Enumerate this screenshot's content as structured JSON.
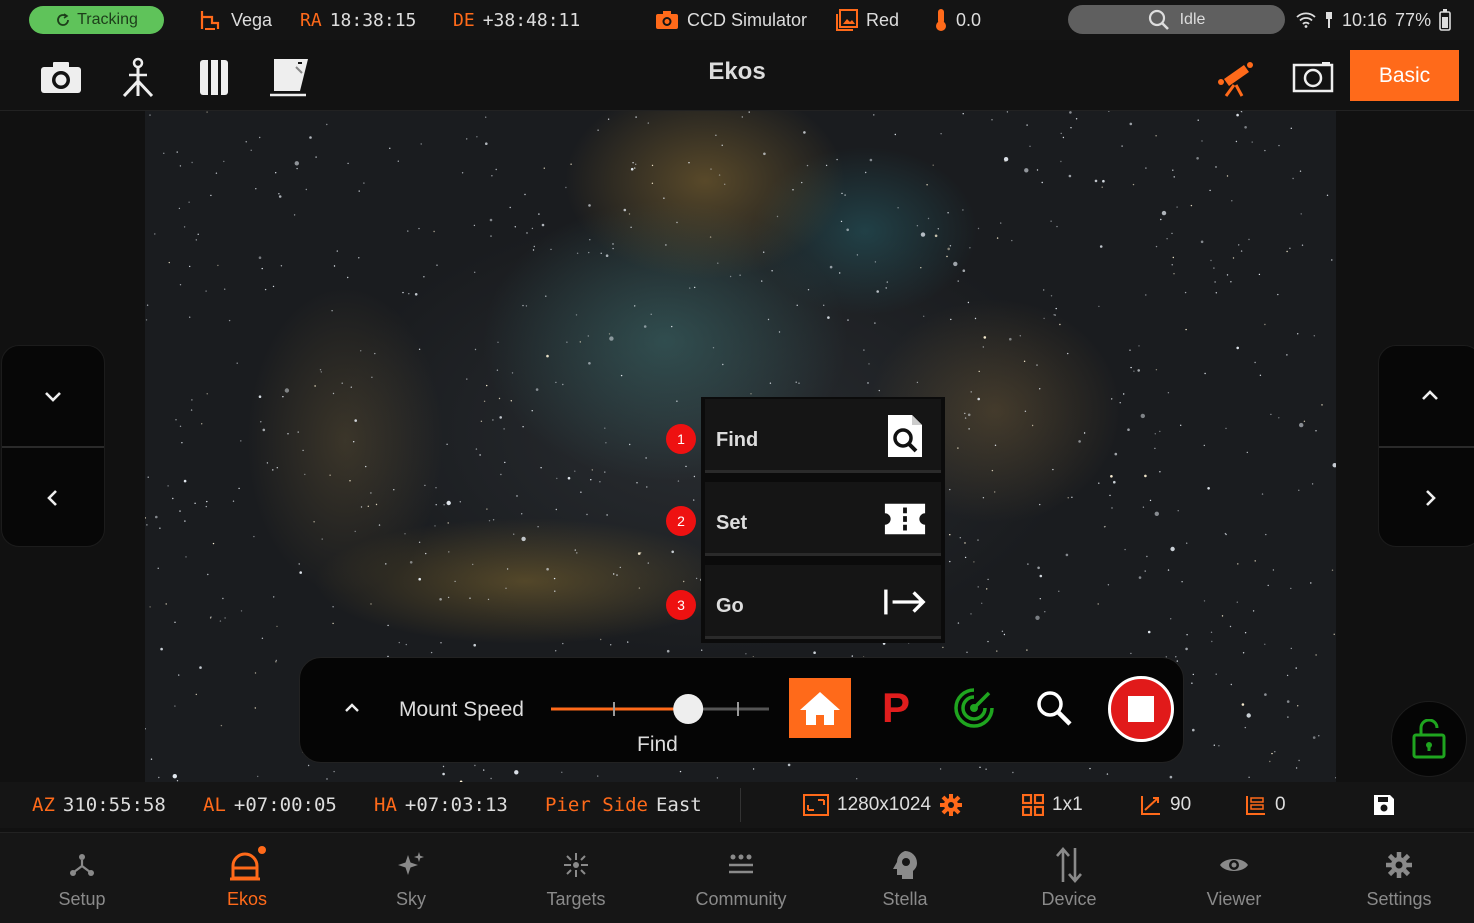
{
  "status_bar": {
    "tracking": "Tracking",
    "target": "Vega",
    "ra_label": "RA",
    "ra_value": "18:38:15",
    "de_label": "DE",
    "de_value": "+38:48:11",
    "camera": "CCD Simulator",
    "filter": "Red",
    "temperature": "0.0",
    "search_status": "Idle",
    "time": "10:16",
    "battery": "77%"
  },
  "toolbar": {
    "title": "Ekos",
    "basic_label": "Basic"
  },
  "align_menu": {
    "items": [
      {
        "num": "1",
        "label": "Find"
      },
      {
        "num": "2",
        "label": "Set"
      },
      {
        "num": "3",
        "label": "Go"
      }
    ]
  },
  "mount_panel": {
    "speed_label": "Mount Speed",
    "speed_value": "Find",
    "speed_level": 0.65,
    "park_letter": "P"
  },
  "info_bar": {
    "az_label": "AZ",
    "az_value": "310:55:58",
    "al_label": "AL",
    "al_value": "+07:00:05",
    "ha_label": "HA",
    "ha_value": "+07:03:13",
    "pier_label": "Pier Side",
    "pier_value": "East",
    "resolution": "1280x1024",
    "binning": "1x1",
    "gain": "90",
    "offset": "0"
  },
  "bottom_nav": {
    "items": [
      {
        "label": "Setup"
      },
      {
        "label": "Ekos"
      },
      {
        "label": "Sky"
      },
      {
        "label": "Targets"
      },
      {
        "label": "Community"
      },
      {
        "label": "Stella"
      },
      {
        "label": "Device"
      },
      {
        "label": "Viewer"
      },
      {
        "label": "Settings"
      }
    ]
  },
  "colors": {
    "accent": "#ff6a1a",
    "tracking": "#5fc35a",
    "stop": "#e11a1a",
    "lock": "#1fa51f"
  }
}
